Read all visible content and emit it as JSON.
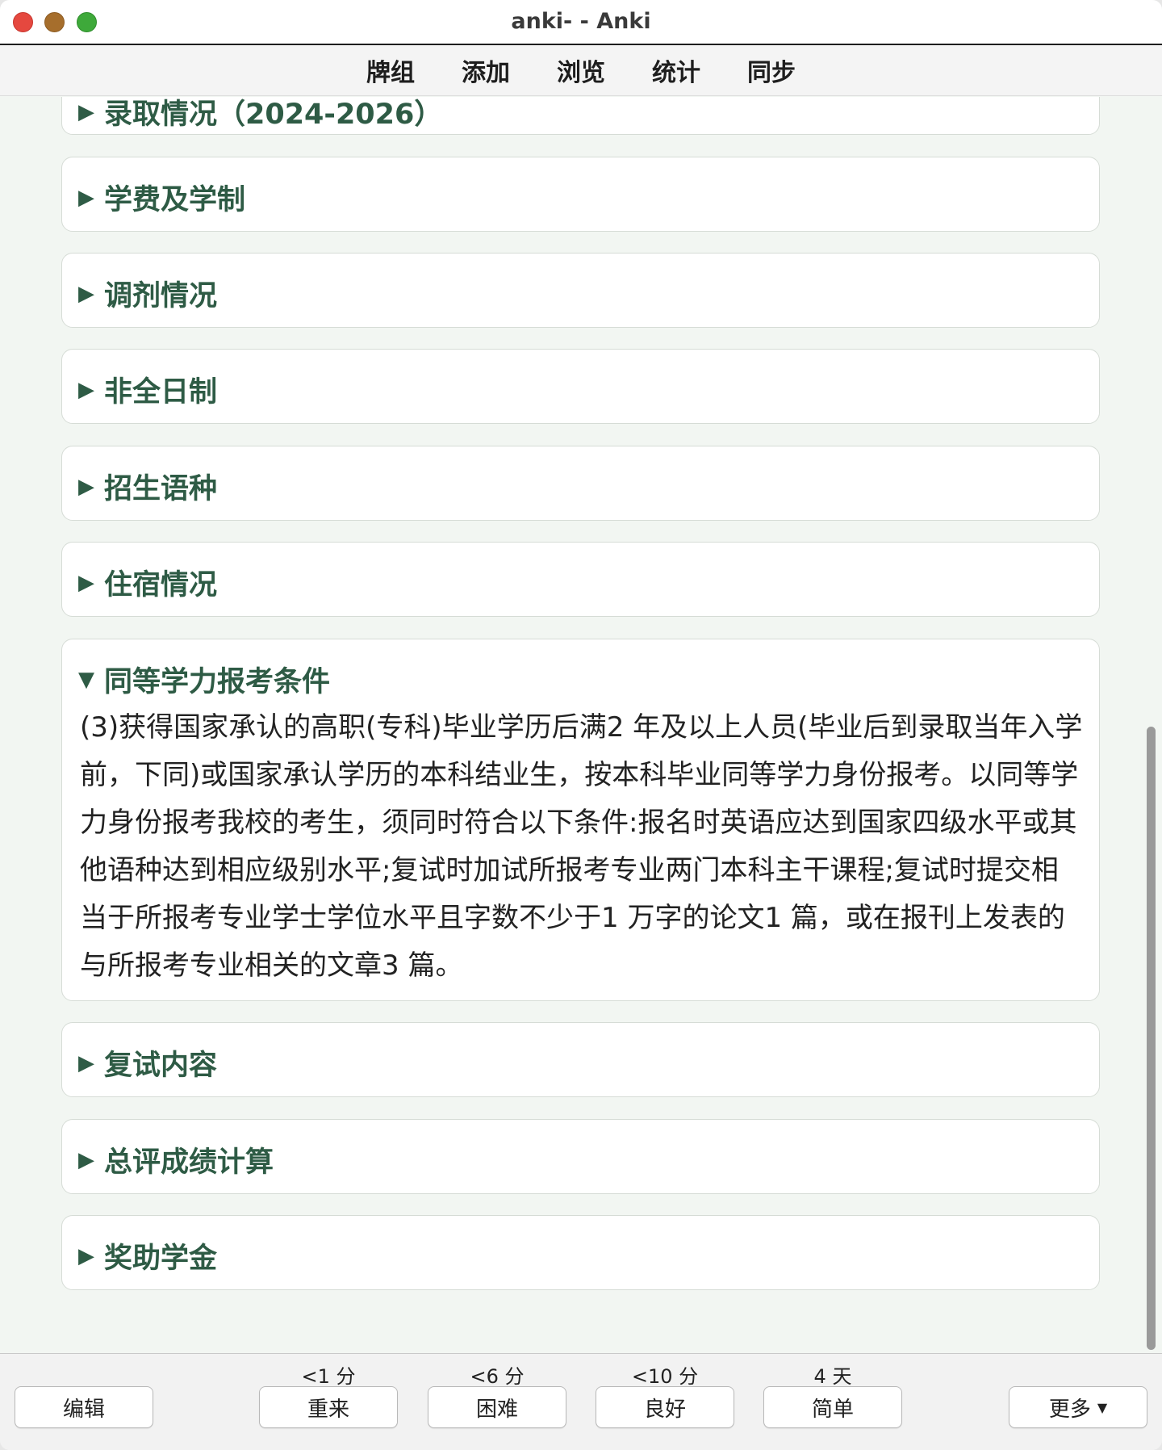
{
  "window": {
    "title": "anki- - Anki"
  },
  "menu": [
    "牌组",
    "添加",
    "浏览",
    "统计",
    "同步"
  ],
  "sections": [
    {
      "title": "录取情况（2024-2026）",
      "expanded": false
    },
    {
      "title": "学费及学制",
      "expanded": false
    },
    {
      "title": "调剂情况",
      "expanded": false
    },
    {
      "title": "非全日制",
      "expanded": false
    },
    {
      "title": "招生语种",
      "expanded": false
    },
    {
      "title": "住宿情况",
      "expanded": false
    },
    {
      "title": "同等学力报考条件",
      "expanded": true,
      "body": "(3)获得国家承认的高职(专科)毕业学历后满2 年及以上人员(毕业后到录取当年入学前，下同)或国家承认学历的本科结业生，按本科毕业同等学力身份报考。以同等学力身份报考我校的考生，须同时符合以下条件:报名时英语应达到国家四级水平或其他语种达到相应级别水平;复试时加试所报考专业两门本科主干课程;复试时提交相当于所报考专业学士学位水平且字数不少于1 万字的论文1 篇，或在报刊上发表的与所报考专业相关的文章3 篇。"
    },
    {
      "title": "复试内容",
      "expanded": false
    },
    {
      "title": "总评成绩计算",
      "expanded": false
    },
    {
      "title": "奖助学金",
      "expanded": false
    }
  ],
  "bottom": {
    "edit": "编辑",
    "more": "更多",
    "answers": [
      {
        "label": "重来",
        "interval": "<1 分"
      },
      {
        "label": "困难",
        "interval": "<6 分"
      },
      {
        "label": "良好",
        "interval": "<10 分"
      },
      {
        "label": "简单",
        "interval": "4 天"
      }
    ]
  },
  "icons": {
    "collapsed": "triangle-right",
    "expanded": "triangle-down",
    "dropdown": "caret-down"
  }
}
